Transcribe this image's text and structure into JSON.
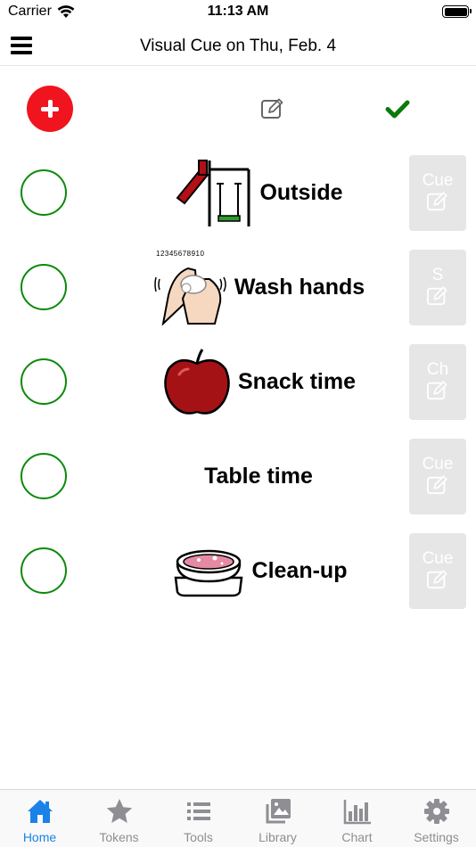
{
  "status_bar": {
    "carrier": "Carrier",
    "time": "11:13 AM"
  },
  "nav": {
    "title": "Visual Cue on Thu, Feb. 4"
  },
  "colors": {
    "accent": "#1b82e8",
    "add_red": "#f0141e",
    "check_green": "#0a8a0a",
    "inactive_tab": "#8e8e93"
  },
  "rows": [
    {
      "label": "Outside",
      "cue": "Cue",
      "image": "playground-picture"
    },
    {
      "label": "Wash hands",
      "cue": "S",
      "image": "wash-hands-picture",
      "image_text": "12345678910"
    },
    {
      "label": "Snack time",
      "cue": "Ch",
      "image": "apple-picture"
    },
    {
      "label": "Table time",
      "cue": "Cue",
      "image": ""
    },
    {
      "label": "Clean-up",
      "cue": "Cue",
      "image": "soap-bowl-picture"
    }
  ],
  "tabs": [
    {
      "label": "Home",
      "icon": "home-icon",
      "active": true
    },
    {
      "label": "Tokens",
      "icon": "star-icon",
      "active": false
    },
    {
      "label": "Tools",
      "icon": "list-icon",
      "active": false
    },
    {
      "label": "Library",
      "icon": "photo-library-icon",
      "active": false
    },
    {
      "label": "Chart",
      "icon": "bar-chart-icon",
      "active": false
    },
    {
      "label": "Settings",
      "icon": "gear-icon",
      "active": false
    }
  ]
}
